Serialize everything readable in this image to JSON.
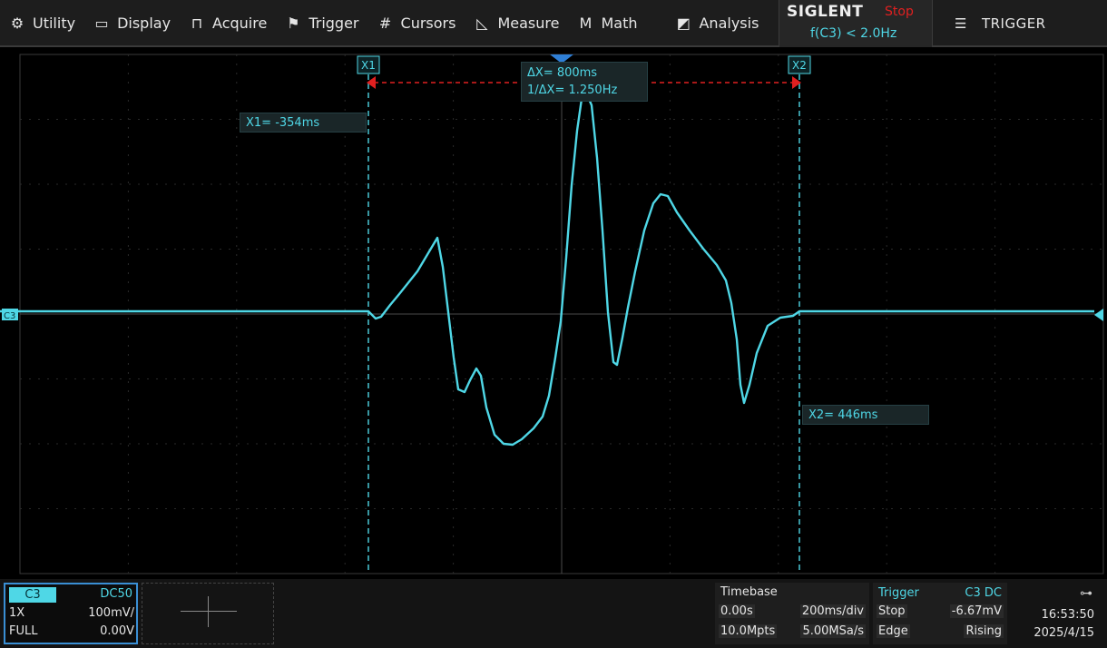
{
  "menu": {
    "items": [
      {
        "label": "Utility",
        "icon": "gear-icon"
      },
      {
        "label": "Display",
        "icon": "monitor-icon"
      },
      {
        "label": "Acquire",
        "icon": "acquire-icon"
      },
      {
        "label": "Trigger",
        "icon": "flag-icon"
      },
      {
        "label": "Cursors",
        "icon": "cursors-icon"
      },
      {
        "label": "Measure",
        "icon": "measure-icon"
      },
      {
        "label": "Math",
        "icon": "math-icon"
      },
      {
        "label": "Analysis",
        "icon": "analysis-icon"
      }
    ],
    "brand": "SIGLENT",
    "run_state": "Stop",
    "trigger_condition": "f(C3) < 2.0Hz",
    "trigger_menu": "TRIGGER"
  },
  "cursors": {
    "x1_label": "X1",
    "x2_label": "X2",
    "x1_value": "X1= -354ms",
    "x2_value": "X2= 446ms",
    "delta_x": "ΔX= 800ms",
    "inv_delta_x": "1/ΔX= 1.250Hz"
  },
  "screen": {
    "channel_marker": "C3"
  },
  "channel": {
    "name": "C3",
    "coupling": "DC50",
    "probe": "1X",
    "scale": "100mV/",
    "bandwidth": "FULL",
    "offset": "0.00V"
  },
  "timebase": {
    "title": "Timebase",
    "delay": "0.00s",
    "scale": "200ms/div",
    "memory_depth": "10.0Mpts",
    "sample_rate": "5.00MSa/s"
  },
  "trigger": {
    "title": "Trigger",
    "source": "C3 DC",
    "state": "Stop",
    "level": "-6.67mV",
    "type": "Edge",
    "slope": "Rising"
  },
  "clock": {
    "time": "16:53:50",
    "date": "2025/4/15"
  },
  "colors": {
    "trace": "#4fd7e6",
    "cursor_line": "#4fd7e6",
    "delta_arrow": "#e02020",
    "run_state": "#e02020"
  }
}
